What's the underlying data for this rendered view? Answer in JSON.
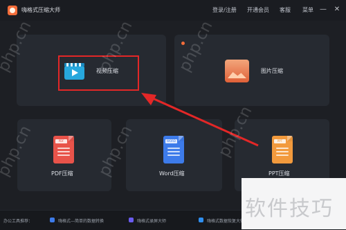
{
  "titlebar": {
    "app_title": "嗨格式压缩大师",
    "menu_login": "登录/注册",
    "menu_open_vip": "开通会员",
    "menu_service": "客服",
    "menu_main": "菜单"
  },
  "cards": {
    "video": {
      "label": "视频压缩"
    },
    "image": {
      "label": "图片压缩"
    },
    "pdf": {
      "label": "PDF压缩",
      "badge": "PDF"
    },
    "word": {
      "label": "Word压缩",
      "badge": "WORD"
    },
    "ppt": {
      "label": "PPT压缩",
      "badge": "PPT"
    }
  },
  "bottom": {
    "label": "办公工具推荐：",
    "items": [
      {
        "label": "嗨格式—简单的数据转换"
      },
      {
        "label": "嗨格式录屏大师"
      },
      {
        "label": "嗨格式数据恢复大师"
      }
    ]
  },
  "watermark": {
    "text": "php.cn",
    "overlay_text": "软件技巧"
  },
  "colors": {
    "background": "#1d1f24",
    "card": "#262a31",
    "highlight": "#e32727",
    "pdf": "#e8534a",
    "word": "#3d7bea",
    "ppt": "#f29a3d"
  }
}
